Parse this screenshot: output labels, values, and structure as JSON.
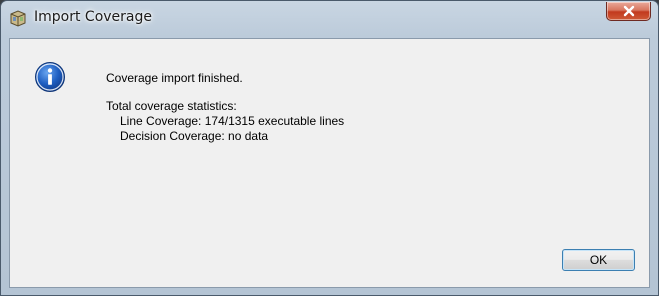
{
  "window": {
    "title": "Import Coverage",
    "close_icon": "close-icon",
    "app_icon": "import-coverage-app-icon"
  },
  "dialog": {
    "icon": "info-icon",
    "heading": "Coverage import finished.",
    "stats_title": "Total coverage statistics:",
    "line_coverage": "Line Coverage: 174/1315 executable lines",
    "decision_coverage": "Decision Coverage: no data"
  },
  "buttons": {
    "ok_label": "OK"
  },
  "colors": {
    "title_bar": "#bccbda",
    "client_background": "#f0f0f0",
    "close_button": "#c94a2c",
    "info_blue": "#1f5fc2",
    "button_border": "#3c7fb1"
  }
}
